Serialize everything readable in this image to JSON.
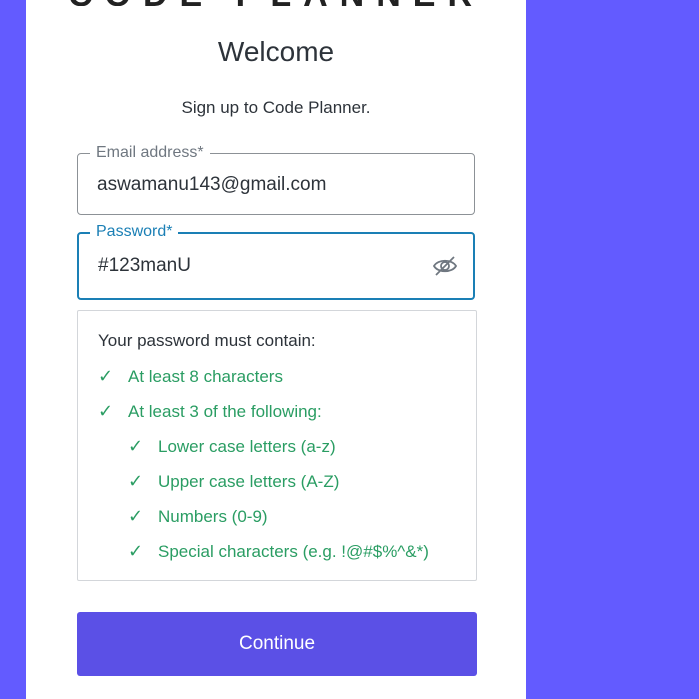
{
  "brand": {
    "logo_text": "Code Planner"
  },
  "header": {
    "title": "Welcome",
    "subtitle": "Sign up to Code Planner."
  },
  "form": {
    "email": {
      "label": "Email address*",
      "value": "aswamanu143@gmail.com"
    },
    "password": {
      "label": "Password*",
      "value": "#123manU",
      "visibility_icon": "eye-off-icon"
    }
  },
  "password_rules": {
    "heading": "Your password must contain:",
    "items": [
      {
        "check": "✓",
        "label": "At least 8 characters"
      },
      {
        "check": "✓",
        "label": "At least 3 of the following:"
      },
      {
        "check": "✓",
        "label": "Lower case letters (a-z)"
      },
      {
        "check": "✓",
        "label": "Upper case letters (A-Z)"
      },
      {
        "check": "✓",
        "label": "Numbers (0-9)"
      },
      {
        "check": "✓",
        "label": "Special characters (e.g. !@#$%^&*)"
      }
    ]
  },
  "actions": {
    "continue_label": "Continue"
  },
  "colors": {
    "background": "#635bff",
    "primary_button": "#5b50e6",
    "focus": "#1a7fb5",
    "success": "#2a9d63"
  }
}
